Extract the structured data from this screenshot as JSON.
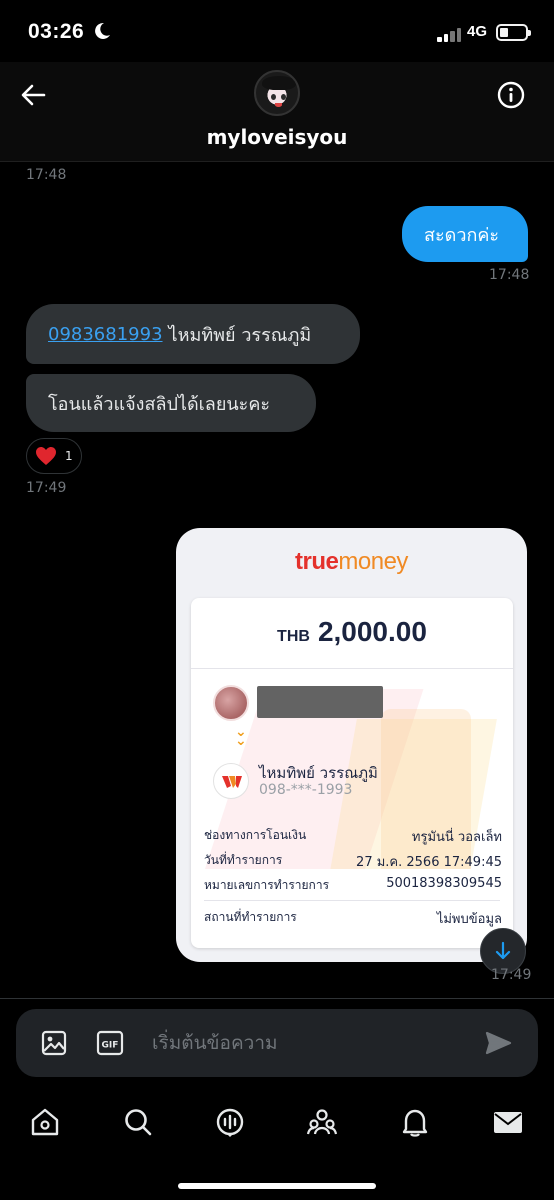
{
  "status_bar": {
    "time": "03:26",
    "network": "4G",
    "icons": [
      "moon-icon",
      "signal-icon",
      "battery-icon"
    ]
  },
  "header": {
    "username": "myloveisyou",
    "icons": [
      "back-arrow-icon",
      "avatar",
      "info-icon"
    ]
  },
  "messages": {
    "ts_top": "17:48",
    "out1_text": "สะดวกค่ะ",
    "out1_time": "17:48",
    "in1_link": "0983681993",
    "in1_rest": "ไหมทิพย์ วรรณภูมิ",
    "in2_text": "โอนแล้วแจ้งสลิปได้เลยนะคะ",
    "reaction_emoji": "heart",
    "reaction_count": "1",
    "in_time": "17:49",
    "slip_time": "17:49"
  },
  "slip": {
    "logo_part1": "true",
    "logo_part2": "money",
    "currency": "THB",
    "amount": "2,000.00",
    "receiver_name": "ไหมทิพย์ วรรณภูมิ",
    "receiver_phone": "098-***-1993",
    "rows": [
      {
        "label": "ช่องทางการโอนเงิน",
        "value": "ทรูมันนี่ วอลเล็ท"
      },
      {
        "label": "วันที่ทำรายการ",
        "value": "27 ม.ค. 2566 17:49:45"
      },
      {
        "label": "หมายเลขการทำรายการ",
        "value": "50018398309545"
      },
      {
        "label": "สถานที่ทำรายการ",
        "value": "ไม่พบข้อมูล"
      }
    ],
    "colors": {
      "brand_red": "#e4312b",
      "brand_orange": "#f08a24"
    }
  },
  "composer": {
    "placeholder": "เริ่มต้นข้อความ",
    "icons": [
      "image-icon",
      "gif-icon",
      "send-icon"
    ]
  },
  "tabbar": {
    "icons": [
      "home-icon",
      "search-icon",
      "spaces-icon",
      "communities-icon",
      "notifications-icon",
      "messages-icon"
    ]
  },
  "colors": {
    "accent": "#1d9bf0",
    "incoming_bubble": "#2f3336",
    "background": "#000000"
  }
}
